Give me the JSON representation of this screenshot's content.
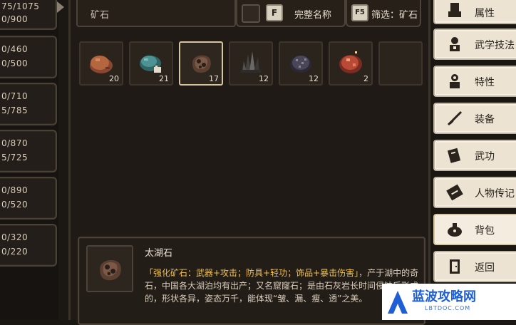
{
  "left_stats": [
    {
      "lines": [
        "75/1075",
        "0/900"
      ]
    },
    {
      "lines": [
        "0/460",
        "0/500"
      ]
    },
    {
      "lines": [
        "0/710",
        "5/785"
      ]
    },
    {
      "lines": [
        "0/870",
        "5/725"
      ]
    },
    {
      "lines": [
        "0/890",
        "0/520"
      ]
    },
    {
      "lines": [
        "0/320",
        "0/220"
      ]
    }
  ],
  "toolbar": {
    "search_text": "矿石",
    "fullname_key": "F",
    "fullname_label": "完整名称",
    "filter_key": "F5",
    "filter_label": "筛选：矿石"
  },
  "items": [
    {
      "count": "20",
      "icon": "brown-ore-icon",
      "color": "#a45a3b"
    },
    {
      "count": "21",
      "icon": "teal-ore-icon",
      "color": "#3f7b7b"
    },
    {
      "count": "17",
      "icon": "taihu-stone-icon",
      "color": "#6b4a39"
    },
    {
      "count": "12",
      "icon": "black-crystal-icon",
      "color": "#5a5754"
    },
    {
      "count": "12",
      "icon": "dark-ore-icon",
      "color": "#3d3a49"
    },
    {
      "count": "2",
      "icon": "red-gem-ore-icon",
      "color": "#a84433"
    },
    {
      "count": "",
      "icon": "empty-slot",
      "color": "#2a241d"
    }
  ],
  "description": {
    "title": "太湖石",
    "highlight": "「强化矿石：武器+攻击；防具+轻功；饰品+暴击伤害」",
    "body": "，产于湖中的奇石，中国各大湖泊均有出产；又名窟窿石；是由石灰岩长时间侵蚀后形成的，形状各异，姿态万千，能体现“皱、漏、瘦、透”之美。"
  },
  "menu": [
    {
      "label": "属性",
      "icon": "attribute-icon"
    },
    {
      "label": "武学技法",
      "icon": "martial-skill-icon"
    },
    {
      "label": "特性",
      "icon": "trait-icon"
    },
    {
      "label": "装备",
      "icon": "equipment-icon"
    },
    {
      "label": "武功",
      "icon": "kungfu-icon"
    },
    {
      "label": "人物传记",
      "icon": "biography-icon"
    },
    {
      "label": "背包",
      "icon": "backpack-icon"
    },
    {
      "label": "返回",
      "icon": "return-icon"
    }
  ],
  "watermark": {
    "text": "蓝波攻略网",
    "sub": "LBTDOC.COM"
  }
}
